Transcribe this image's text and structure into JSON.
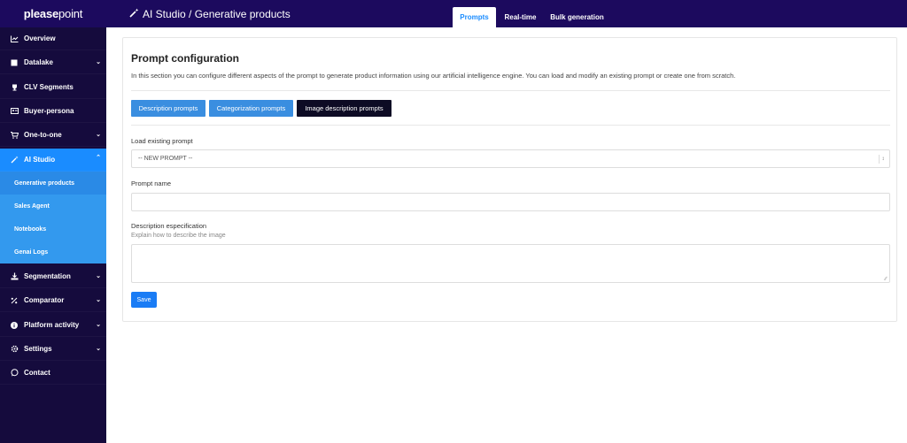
{
  "brand": {
    "part1": "please",
    "part2": "point"
  },
  "breadcrumb": "AI Studio / Generative products",
  "tabs": [
    {
      "label": "Prompts",
      "active": true
    },
    {
      "label": "Real-time",
      "active": false
    },
    {
      "label": "Bulk generation",
      "active": false
    }
  ],
  "sidebar": {
    "items": [
      {
        "label": "Overview",
        "icon": "chart-line-icon"
      },
      {
        "label": "Datalake",
        "icon": "database-icon"
      },
      {
        "label": "CLV Segments",
        "icon": "trophy-icon"
      },
      {
        "label": "Buyer-persona",
        "icon": "id-card-icon"
      },
      {
        "label": "One-to-one",
        "icon": "cart-icon"
      },
      {
        "label": "AI Studio",
        "icon": "magic-wand-icon"
      },
      {
        "label": "Segmentation",
        "icon": "download-icon"
      },
      {
        "label": "Comparator",
        "icon": "percent-icon"
      },
      {
        "label": "Platform activity",
        "icon": "info-icon"
      },
      {
        "label": "Settings",
        "icon": "gear-icon"
      },
      {
        "label": "Contact",
        "icon": "chat-icon"
      }
    ],
    "subitems": [
      {
        "label": "Generative products"
      },
      {
        "label": "Sales Agent"
      },
      {
        "label": "Notebooks"
      },
      {
        "label": "Genai Logs"
      }
    ]
  },
  "main": {
    "title": "Prompt configuration",
    "description": "In this section you can configure different aspects of the prompt to generate product information using our artificial intelligence engine. You can load and modify an existing prompt or create one from scratch.",
    "buttons": {
      "description": "Description prompts",
      "categorization": "Categorization prompts",
      "image": "Image description prompts"
    },
    "load_label": "Load existing prompt",
    "select_value": "-- NEW PROMPT --",
    "prompt_name_label": "Prompt name",
    "prompt_name_value": "",
    "desc_spec_label": "Description especification",
    "desc_spec_hint": "Explain how to describe the image",
    "save_label": "Save"
  },
  "colors": {
    "topbar": "#1c0a5e",
    "sidebar": "#150b3d",
    "active": "#1a8cff",
    "submenu": "#3399ee"
  }
}
